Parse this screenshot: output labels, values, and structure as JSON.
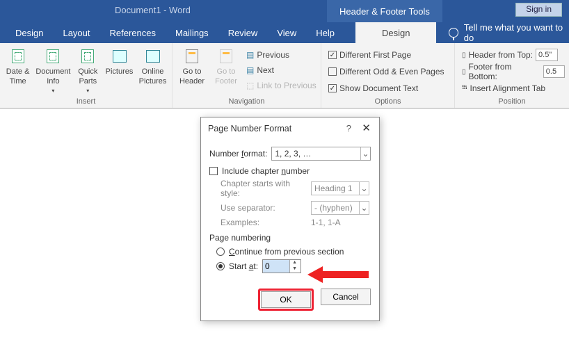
{
  "titlebar": {
    "doc": "Document1  -  Word",
    "tooltab": "Header & Footer Tools",
    "signin": "Sign in"
  },
  "tabs": {
    "items": [
      "Design",
      "Layout",
      "References",
      "Mailings",
      "Review",
      "View",
      "Help"
    ],
    "active": "Design",
    "tellme": "Tell me what you want to do"
  },
  "ribbon": {
    "insert": {
      "label": "Insert",
      "datetime": "Date &\nTime",
      "docinfo": "Document\nInfo",
      "quickparts": "Quick\nParts",
      "pictures": "Pictures",
      "onlinepics": "Online\nPictures"
    },
    "navigation": {
      "label": "Navigation",
      "gotoheader": "Go to\nHeader",
      "gotofooter": "Go to\nFooter",
      "previous": "Previous",
      "next": "Next",
      "link": "Link to Previous"
    },
    "options": {
      "label": "Options",
      "diff_first": "Different First Page",
      "diff_oddeven": "Different Odd & Even Pages",
      "show_doc": "Show Document Text"
    },
    "position": {
      "label": "Position",
      "header_from_top": "Header from Top:",
      "footer_from_bottom": "Footer from Bottom:",
      "insert_align": "Insert Alignment Tab",
      "header_val": "0.5\"",
      "footer_val": "0.5"
    }
  },
  "dialog": {
    "title": "Page Number Format",
    "number_format_label": "Number format:",
    "number_format_value": "1, 2, 3, …",
    "include_chapter": "Include chapter number",
    "chapter_style_label": "Chapter starts with style:",
    "chapter_style_value": "Heading 1",
    "separator_label": "Use separator:",
    "separator_value": "-   (hyphen)",
    "examples_label": "Examples:",
    "examples_value": "1-1, 1-A",
    "page_numbering": "Page numbering",
    "continue": "Continue from previous section",
    "start_at_label": "Start at:",
    "start_at_value": "0",
    "ok": "OK",
    "cancel": "Cancel"
  }
}
